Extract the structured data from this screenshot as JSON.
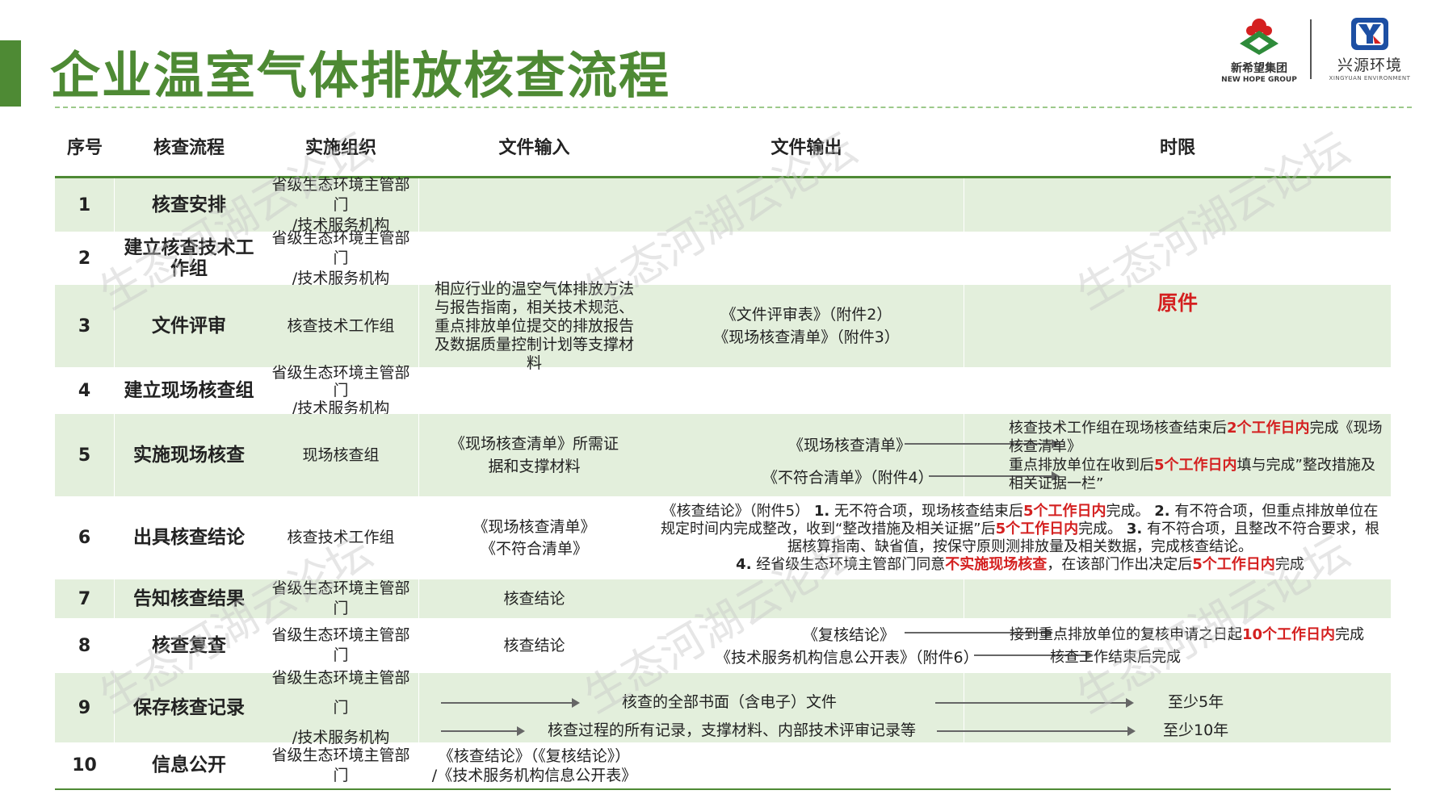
{
  "title": "企业温室气体排放核查流程",
  "logos": {
    "left": {
      "cn": "新希望集团",
      "en": "NEW HOPE GROUP"
    },
    "right": {
      "cn": "兴源环境",
      "en": "XINGYUAN ENVIRONMENT"
    }
  },
  "watermark": "生态河湖云论坛",
  "colors": {
    "accent": "#4e8a34",
    "row_fill": "#e3efdc",
    "highlight": "#d42020"
  },
  "headers": [
    "序号",
    "核查流程",
    "实施组织",
    "文件输入",
    "文件输出",
    "时限"
  ],
  "rows": {
    "r1": {
      "no": "1",
      "step": "核查安排",
      "org1": "省级生态环境主管部门",
      "org2": "/技术服务机构"
    },
    "r2": {
      "no": "2",
      "step1": "建立核查技术工",
      "step2": "作组",
      "org1": "省级生态环境主管部门",
      "org2": "/技术服务机构"
    },
    "r3": {
      "no": "3",
      "step": "文件评审",
      "org": "核查技术工作组",
      "input": "相应行业的温空气体排放方法与报告指南，相关技术规范、重点排放单位提交的排放报告及数据质量控制计划等支撑材料",
      "out1": "《文件评审表》（附件2）",
      "out2": "《现场核查清单》（附件3）",
      "limit": "原件"
    },
    "r4": {
      "no": "4",
      "step": "建立现场核查组",
      "org1": "省级生态环境主管部门",
      "org2": "/技术服务机构"
    },
    "r5": {
      "no": "5",
      "step": "实施现场核查",
      "org": "现场核查组",
      "in1": "《现场核查清单》所需证",
      "in2": "据和支撑材料",
      "out1": "《现场核查清单》",
      "out2": "《不符合清单》（附件4）",
      "lim1a": "核查技术工作组在现场核查结束后",
      "lim1b": "2个工作日内",
      "lim1c": "完成《现场核查清单》",
      "lim2a": "重点排放单位在收到后",
      "lim2b": "5个工作日内",
      "lim2c": "填与完成”整改措施及相关证据一栏”"
    },
    "r6": {
      "no": "6",
      "step": "出具核查结论",
      "org": "核查技术工作组",
      "in1": "《现场核查清单》",
      "in2": "《不符合清单》",
      "t1": "《核查结论》（附件5）   ",
      "t2": "1.",
      "t3": " 无不符合项，现场核查结束后",
      "t4": "5个工作日内",
      "t5": "完成。   ",
      "t6": "2.",
      "t7": " 有不符合项，但重点排放单位在规定时间内完成整改，收到“整改措施及相关证据”后",
      "t8": "5个工作日内",
      "t9": "完成。   ",
      "t10": "3.",
      "t11": " 有不符合项，且整改不符合要求，根据核算指南、缺省值，按保守原则测排放量及相关数据，完成核查结论。",
      "t12": "4.",
      "t13": " 经省级生态环境主管部门同意",
      "t14": "不实施现场核查",
      "t15": "，在该部门作出决定后",
      "t16": "5个工作日内",
      "t17": "完成"
    },
    "r7": {
      "no": "7",
      "step": "告知核查结果",
      "org": "省级生态环境主管部门",
      "input": "核查结论"
    },
    "r8": {
      "no": "8",
      "step": "核查复查",
      "org": "省级生态环境主管部门",
      "input": "核查结论",
      "out1": "《复核结论》",
      "out2": "《技术服务机构信息公开表》（附件6）",
      "lim1a": "接到重点排放单位的复核申请之日起",
      "lim1b": "10个工作日内",
      "lim1c": "完成",
      "lim2": "核查工作结束后完成"
    },
    "r9": {
      "no": "9",
      "step": "保存核查记录",
      "org1": "省级生态环境主管部门",
      "org2": "/技术服务机构",
      "doc1": "核查的全部书面（含电子）文件",
      "doc2": "核查过程的所有记录，支撑材料、内部技术评审记录等",
      "lim1": "至少5年",
      "lim2": "至少10年"
    },
    "r10": {
      "no": "10",
      "step": "信息公开",
      "org": "省级生态环境主管部门",
      "in1": "《核查结论》（《复核结论》）",
      "in2": "/《技术服务机构信息公开表》"
    }
  }
}
